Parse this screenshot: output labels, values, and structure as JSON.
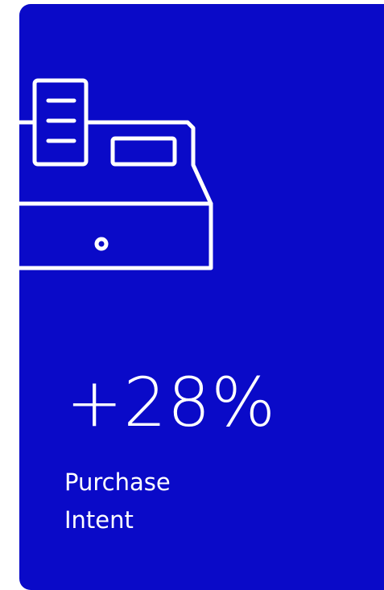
{
  "card": {
    "background_color": "#0a0ac8",
    "icon": "cash-register-icon",
    "value": "+28%",
    "label": "Purchase\nIntent",
    "text_color": "#ffffff"
  }
}
